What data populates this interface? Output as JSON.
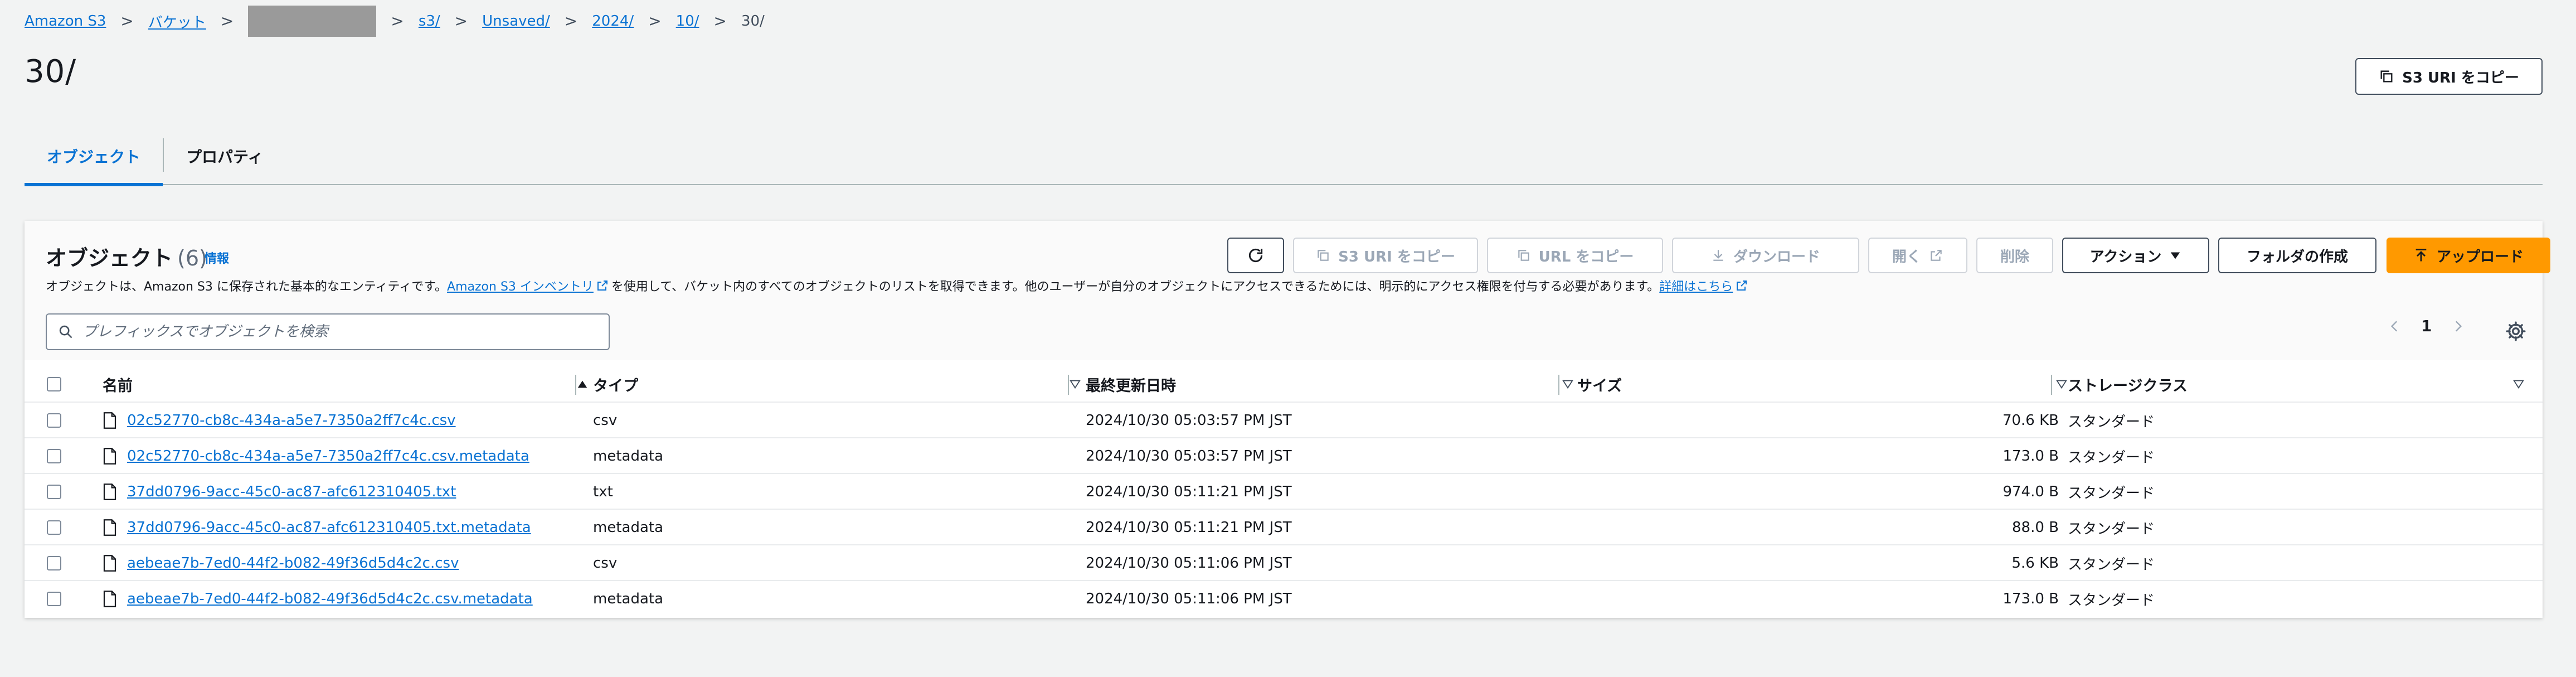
{
  "breadcrumb": {
    "items": [
      "Amazon S3",
      "バケット",
      "",
      "s3/",
      "Unsaved/",
      "2024/",
      "10/"
    ],
    "current": "30/",
    "separator": ">"
  },
  "page": {
    "title": "30/"
  },
  "header": {
    "copy_s3_uri_label": "S3 URI をコピー"
  },
  "tabs": [
    {
      "label": "オブジェクト",
      "active": true
    },
    {
      "label": "プロパティ",
      "active": false
    }
  ],
  "objects_panel": {
    "title": "オブジェクト",
    "count": "(6)",
    "info_label": "情報",
    "desc_part1": "オブジェクトは、Amazon S3 に保存された基本的なエンティティです。",
    "desc_link1": "Amazon S3 インベントリ",
    "desc_part2": "を使用して、バケット内のすべてのオブジェクトのリストを取得できます。他のユーザーが自分のオブジェクトにアクセスできるためには、明示的にアクセス権限を付与する必要があります。",
    "desc_link2": "詳細はこちら",
    "toolbar": {
      "copy_s3_uri": "S3 URI をコピー",
      "copy_url": "URL をコピー",
      "download": "ダウンロード",
      "open": "開く",
      "delete": "削除",
      "actions": "アクション",
      "create_folder": "フォルダの作成",
      "upload": "アップロード"
    },
    "search_placeholder": "プレフィックスでオブジェクトを検索",
    "pagination": {
      "page": "1"
    },
    "columns": [
      "名前",
      "タイプ",
      "最終更新日時",
      "サイズ",
      "ストレージクラス"
    ],
    "rows": [
      {
        "name": "02c52770-cb8c-434a-a5e7-7350a2ff7c4c.csv",
        "type": "csv",
        "modified": "2024/10/30 05:03:57 PM JST",
        "size": "70.6 KB",
        "storage": "スタンダード"
      },
      {
        "name": "02c52770-cb8c-434a-a5e7-7350a2ff7c4c.csv.metadata",
        "type": "metadata",
        "modified": "2024/10/30 05:03:57 PM JST",
        "size": "173.0 B",
        "storage": "スタンダード"
      },
      {
        "name": "37dd0796-9acc-45c0-ac87-afc612310405.txt",
        "type": "txt",
        "modified": "2024/10/30 05:11:21 PM JST",
        "size": "974.0 B",
        "storage": "スタンダード"
      },
      {
        "name": "37dd0796-9acc-45c0-ac87-afc612310405.txt.metadata",
        "type": "metadata",
        "modified": "2024/10/30 05:11:21 PM JST",
        "size": "88.0 B",
        "storage": "スタンダード"
      },
      {
        "name": "aebeae7b-7ed0-44f2-b082-49f36d5d4c2c.csv",
        "type": "csv",
        "modified": "2024/10/30 05:11:06 PM JST",
        "size": "5.6 KB",
        "storage": "スタンダード"
      },
      {
        "name": "aebeae7b-7ed0-44f2-b082-49f36d5d4c2c.csv.metadata",
        "type": "metadata",
        "modified": "2024/10/30 05:11:06 PM JST",
        "size": "173.0 B",
        "storage": "スタンダード"
      }
    ]
  },
  "colors": {
    "link": "#0972d3",
    "primary": "#ff9900",
    "text": "#16191f",
    "background": "#f2f3f3"
  }
}
